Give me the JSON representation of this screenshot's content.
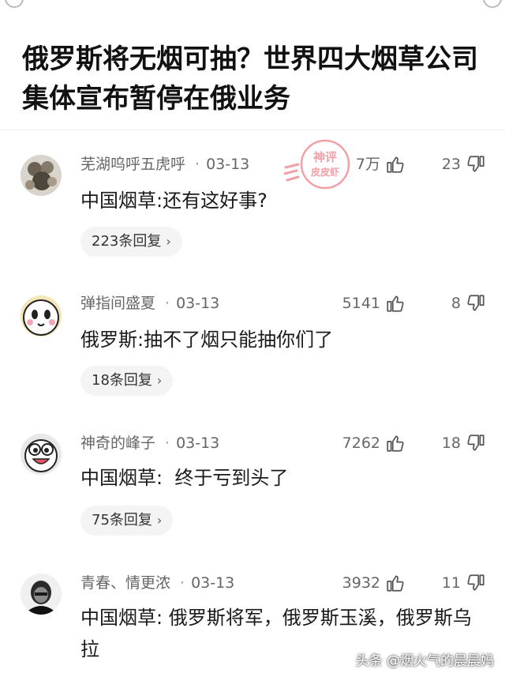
{
  "article": {
    "title": "俄罗斯将无烟可抽？世界四大烟草公司集体宣布暂停在俄业务"
  },
  "stamp": {
    "line1": "神评",
    "line2": "皮皮虾",
    "color": "#f2a0a6"
  },
  "comments": [
    {
      "username": "芜湖呜呼五虎呼",
      "date": "03-13",
      "likes": "7万",
      "dislikes": "23",
      "text": "中国烟草:还有这好事?",
      "replies": "223条回复"
    },
    {
      "username": "弹指间盛夏",
      "date": "03-13",
      "likes": "5141",
      "dislikes": "8",
      "text": "俄罗斯:抽不了烟只能抽你们了",
      "replies": "18条回复"
    },
    {
      "username": "神奇的峰子",
      "date": "03-13",
      "likes": "7262",
      "dislikes": "18",
      "text": "中国烟草:  终于亏到头了",
      "replies": "75条回复"
    },
    {
      "username": "青春、情更浓",
      "date": "03-13",
      "likes": "3932",
      "dislikes": "11",
      "text": "中国烟草:  俄罗斯将军，俄罗斯玉溪，俄罗斯乌拉",
      "replies": ""
    }
  ],
  "watermark": "头条 @烟火气的晨晨妈",
  "icons": {
    "like": "thumbs-up-icon",
    "dislike": "thumbs-down-icon",
    "chevron": "chevron-right-icon"
  },
  "colors": {
    "text": "#1a1a1a",
    "meta": "#666666",
    "pill_bg": "#f4f4f4",
    "divider": "#ececec"
  }
}
